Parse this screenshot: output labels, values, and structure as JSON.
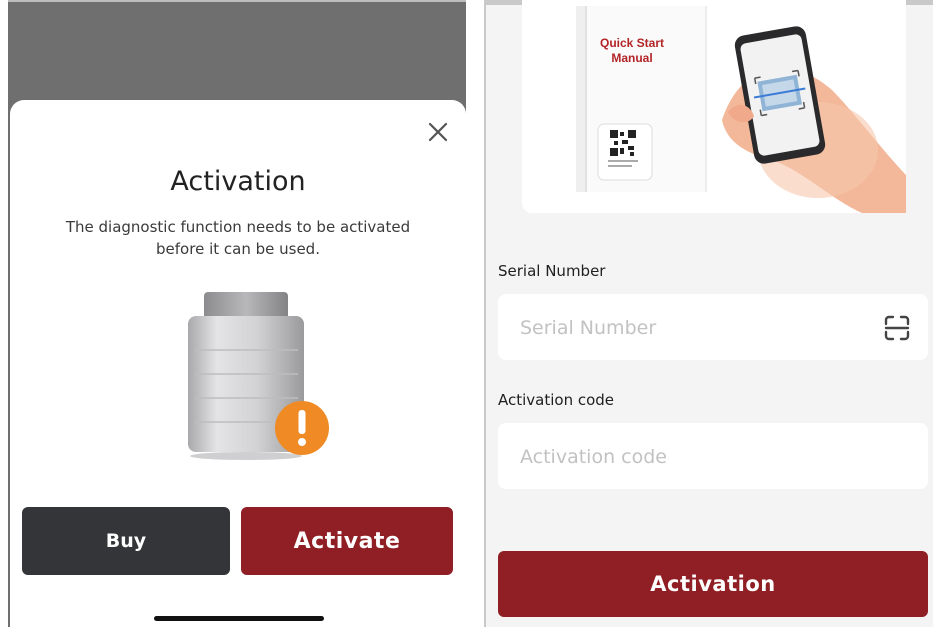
{
  "left": {
    "dialog": {
      "title": "Activation",
      "description": "The diagnostic function needs to be activated before it can be used.",
      "close_icon": "close-icon",
      "device_icon": "obd-connector-icon",
      "warning_icon": "exclamation-badge-icon"
    },
    "buttons": {
      "buy": "Buy",
      "activate": "Activate"
    }
  },
  "right": {
    "illustration": {
      "manual_title": "Quick Start Manual",
      "phone_icon": "phone-scanning-icon"
    },
    "serial": {
      "label": "Serial Number",
      "placeholder": "Serial Number",
      "scan_icon": "scan-icon"
    },
    "activation_code": {
      "label": "Activation code",
      "placeholder": "Activation code"
    },
    "submit_label": "Activation"
  },
  "colors": {
    "primary": "#8f1f24",
    "dark_button": "#333538",
    "warning": "#f08a24",
    "overlay": "#6f6f6f"
  }
}
